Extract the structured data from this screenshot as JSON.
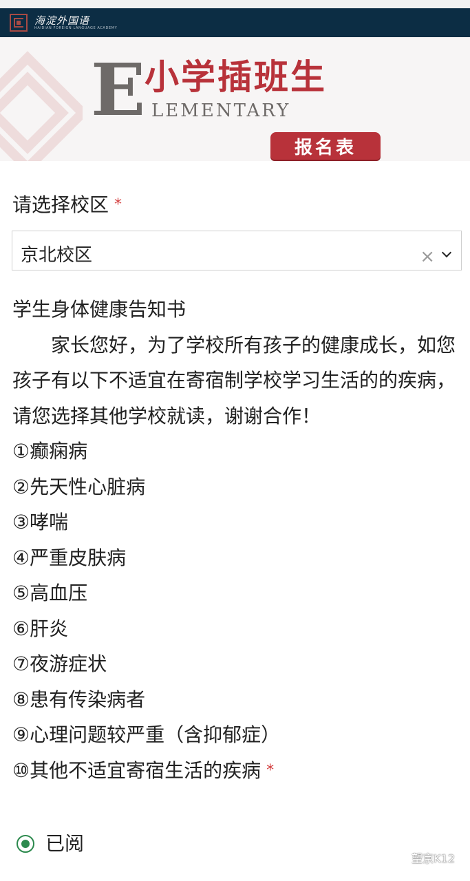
{
  "header": {
    "logo_text": "海淀外国语",
    "logo_subtext": "HAIDIAN FOREIGN LANGUAGE ACADEMY"
  },
  "banner": {
    "letter": "E",
    "title_cn": "小学插班生",
    "title_en": "LEMENTARY",
    "badge": "报名表"
  },
  "campus_field": {
    "label": "请选择校区",
    "required_mark": "*",
    "value": "京北校区",
    "clear_symbol": "×"
  },
  "health_notice": {
    "title": "学生身体健康告知书",
    "body": "家长您好，为了学校所有孩子的健康成长，如您孩子有以下不适宜在寄宿制学校学习生活的的疾病，请您选择其他学校就读，谢谢合作！",
    "items": [
      "①癫痫病",
      "②先天性心脏病",
      "③哮喘",
      "④严重皮肤病",
      "⑤高血压",
      "⑥肝炎",
      "⑦夜游症状",
      "⑧患有传染病者",
      "⑨心理问题较严重（含抑郁症）",
      "⑩其他不适宜寄宿生活的疾病"
    ],
    "required_mark": "*"
  },
  "acknowledge": {
    "label": "已阅",
    "selected": true
  },
  "watermark": {
    "text": "望京K12"
  },
  "colors": {
    "nav_bg": "#0c2d44",
    "brand_red": "#b8323a",
    "radio_green": "#2d8a4e",
    "required_red": "#d33b3b"
  }
}
